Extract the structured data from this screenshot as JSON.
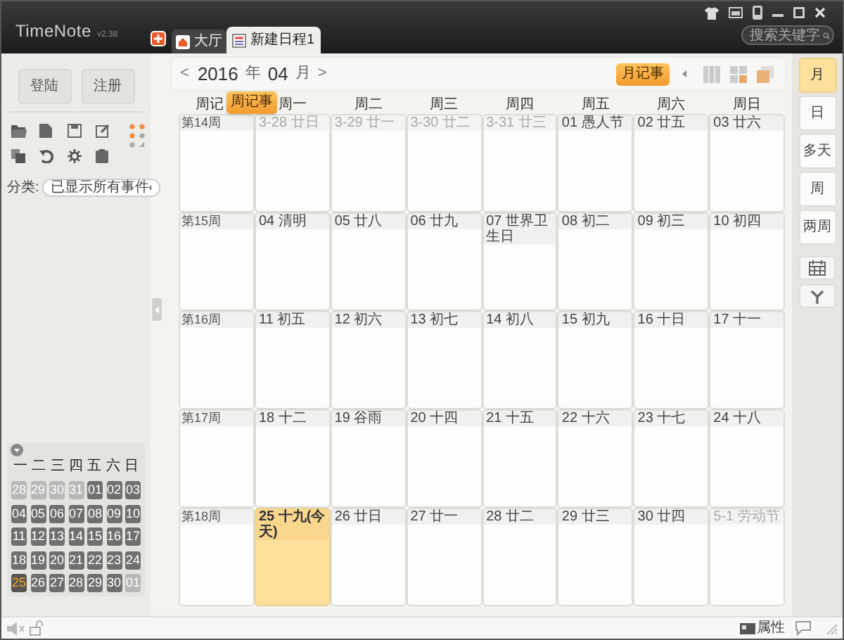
{
  "app": {
    "name": "TimeNote",
    "version": "v2.38"
  },
  "tabs": [
    {
      "label": "大厅",
      "kind": "home",
      "selected": false
    },
    {
      "label": "新建日程1",
      "kind": "doc",
      "selected": true
    }
  ],
  "search": {
    "placeholder": "搜索关键字"
  },
  "account_buttons": [
    "登陆",
    "注册"
  ],
  "category": {
    "label": "分类:",
    "value": "已显示所有事件"
  },
  "mini_calendar": {
    "weekdays": [
      "一",
      "二",
      "三",
      "四",
      "五",
      "六",
      "日"
    ],
    "days": [
      {
        "label": "28",
        "muted": true,
        "today": false
      },
      {
        "label": "29",
        "muted": true,
        "today": false
      },
      {
        "label": "30",
        "muted": true,
        "today": false
      },
      {
        "label": "31",
        "muted": true,
        "today": false
      },
      {
        "label": "01",
        "muted": false,
        "today": false
      },
      {
        "label": "02",
        "muted": false,
        "today": false
      },
      {
        "label": "03",
        "muted": false,
        "today": false
      },
      {
        "label": "04",
        "muted": false,
        "today": false
      },
      {
        "label": "05",
        "muted": false,
        "today": false
      },
      {
        "label": "06",
        "muted": false,
        "today": false
      },
      {
        "label": "07",
        "muted": false,
        "today": false
      },
      {
        "label": "08",
        "muted": false,
        "today": false
      },
      {
        "label": "09",
        "muted": false,
        "today": false
      },
      {
        "label": "10",
        "muted": false,
        "today": false
      },
      {
        "label": "11",
        "muted": false,
        "today": false
      },
      {
        "label": "12",
        "muted": false,
        "today": false
      },
      {
        "label": "13",
        "muted": false,
        "today": false
      },
      {
        "label": "14",
        "muted": false,
        "today": false
      },
      {
        "label": "15",
        "muted": false,
        "today": false
      },
      {
        "label": "16",
        "muted": false,
        "today": false
      },
      {
        "label": "17",
        "muted": false,
        "today": false
      },
      {
        "label": "18",
        "muted": false,
        "today": false
      },
      {
        "label": "19",
        "muted": false,
        "today": false
      },
      {
        "label": "20",
        "muted": false,
        "today": false
      },
      {
        "label": "21",
        "muted": false,
        "today": false
      },
      {
        "label": "22",
        "muted": false,
        "today": false
      },
      {
        "label": "23",
        "muted": false,
        "today": false
      },
      {
        "label": "24",
        "muted": false,
        "today": false
      },
      {
        "label": "25",
        "muted": false,
        "today": true
      },
      {
        "label": "26",
        "muted": false,
        "today": false
      },
      {
        "label": "27",
        "muted": false,
        "today": false
      },
      {
        "label": "28",
        "muted": false,
        "today": false
      },
      {
        "label": "29",
        "muted": false,
        "today": false
      },
      {
        "label": "30",
        "muted": false,
        "today": false
      },
      {
        "label": "01",
        "muted": true,
        "today": false
      }
    ]
  },
  "nav": {
    "prev": "<",
    "year": "2016",
    "year_unit": "年",
    "month": "04",
    "month_unit": "月",
    "next": ">"
  },
  "month_notes_button": "月记事",
  "week_notes_button": "周记事",
  "columns": [
    "周记",
    "周一",
    "周二",
    "周三",
    "周四",
    "周五",
    "周六",
    "周日"
  ],
  "weeks": [
    {
      "label": "第14周",
      "days": [
        {
          "label": "3-28 廿日",
          "muted": true,
          "today": false
        },
        {
          "label": "3-29 廿一",
          "muted": true,
          "today": false
        },
        {
          "label": "3-30 廿二",
          "muted": true,
          "today": false
        },
        {
          "label": "3-31 廿三",
          "muted": true,
          "today": false
        },
        {
          "label": "01 愚人节",
          "muted": false,
          "today": false
        },
        {
          "label": "02 廿五",
          "muted": false,
          "today": false
        },
        {
          "label": "03 廿六",
          "muted": false,
          "today": false
        }
      ]
    },
    {
      "label": "第15周",
      "days": [
        {
          "label": "04 清明",
          "muted": false,
          "today": false
        },
        {
          "label": "05 廿八",
          "muted": false,
          "today": false
        },
        {
          "label": "06 廿九",
          "muted": false,
          "today": false
        },
        {
          "label": "07 世界卫生日",
          "muted": false,
          "today": false
        },
        {
          "label": "08 初二",
          "muted": false,
          "today": false
        },
        {
          "label": "09 初三",
          "muted": false,
          "today": false
        },
        {
          "label": "10 初四",
          "muted": false,
          "today": false
        }
      ]
    },
    {
      "label": "第16周",
      "days": [
        {
          "label": "11 初五",
          "muted": false,
          "today": false
        },
        {
          "label": "12 初六",
          "muted": false,
          "today": false
        },
        {
          "label": "13 初七",
          "muted": false,
          "today": false
        },
        {
          "label": "14 初八",
          "muted": false,
          "today": false
        },
        {
          "label": "15 初九",
          "muted": false,
          "today": false
        },
        {
          "label": "16 十日",
          "muted": false,
          "today": false
        },
        {
          "label": "17 十一",
          "muted": false,
          "today": false
        }
      ]
    },
    {
      "label": "第17周",
      "days": [
        {
          "label": "18 十二",
          "muted": false,
          "today": false
        },
        {
          "label": "19 谷雨",
          "muted": false,
          "today": false
        },
        {
          "label": "20 十四",
          "muted": false,
          "today": false
        },
        {
          "label": "21 十五",
          "muted": false,
          "today": false
        },
        {
          "label": "22 十六",
          "muted": false,
          "today": false
        },
        {
          "label": "23 十七",
          "muted": false,
          "today": false
        },
        {
          "label": "24 十八",
          "muted": false,
          "today": false
        }
      ]
    },
    {
      "label": "第18周",
      "days": [
        {
          "label": "25 十九(今天)",
          "muted": false,
          "today": true
        },
        {
          "label": "26 廿日",
          "muted": false,
          "today": false
        },
        {
          "label": "27 廿一",
          "muted": false,
          "today": false
        },
        {
          "label": "28 廿二",
          "muted": false,
          "today": false
        },
        {
          "label": "29 廿三",
          "muted": false,
          "today": false
        },
        {
          "label": "30 廿四",
          "muted": false,
          "today": false
        },
        {
          "label": "5-1 劳动节",
          "muted": true,
          "today": false
        }
      ]
    }
  ],
  "view_modes": [
    {
      "label": "月",
      "selected": true
    },
    {
      "label": "日",
      "selected": false
    },
    {
      "label": "多天",
      "selected": false
    },
    {
      "label": "周",
      "selected": false
    },
    {
      "label": "两周",
      "selected": false
    }
  ],
  "status_bar": {
    "properties": "属性"
  }
}
